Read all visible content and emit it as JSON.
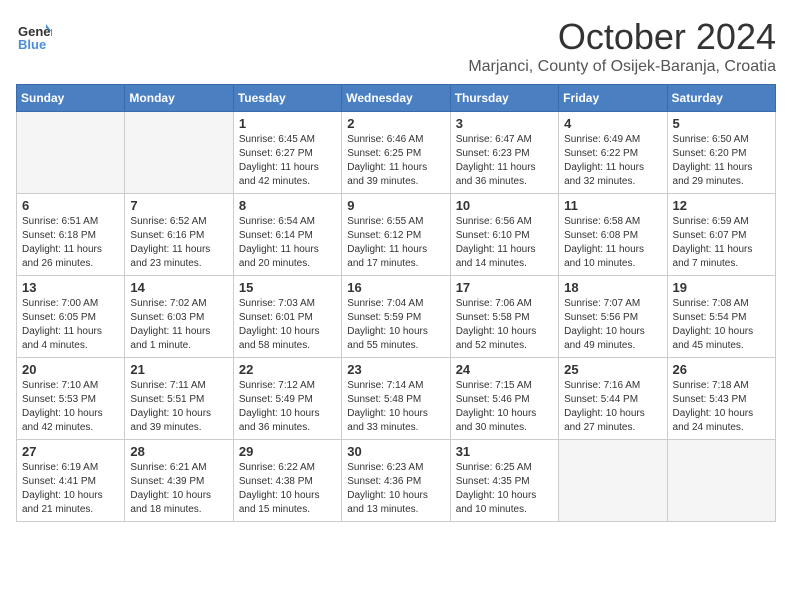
{
  "header": {
    "logo_line1": "General",
    "logo_line2": "Blue",
    "month_title": "October 2024",
    "subtitle": "Marjanci, County of Osijek-Baranja, Croatia"
  },
  "days_of_week": [
    "Sunday",
    "Monday",
    "Tuesday",
    "Wednesday",
    "Thursday",
    "Friday",
    "Saturday"
  ],
  "weeks": [
    [
      {
        "day": "",
        "info": ""
      },
      {
        "day": "",
        "info": ""
      },
      {
        "day": "1",
        "info": "Sunrise: 6:45 AM\nSunset: 6:27 PM\nDaylight: 11 hours and 42 minutes."
      },
      {
        "day": "2",
        "info": "Sunrise: 6:46 AM\nSunset: 6:25 PM\nDaylight: 11 hours and 39 minutes."
      },
      {
        "day": "3",
        "info": "Sunrise: 6:47 AM\nSunset: 6:23 PM\nDaylight: 11 hours and 36 minutes."
      },
      {
        "day": "4",
        "info": "Sunrise: 6:49 AM\nSunset: 6:22 PM\nDaylight: 11 hours and 32 minutes."
      },
      {
        "day": "5",
        "info": "Sunrise: 6:50 AM\nSunset: 6:20 PM\nDaylight: 11 hours and 29 minutes."
      }
    ],
    [
      {
        "day": "6",
        "info": "Sunrise: 6:51 AM\nSunset: 6:18 PM\nDaylight: 11 hours and 26 minutes."
      },
      {
        "day": "7",
        "info": "Sunrise: 6:52 AM\nSunset: 6:16 PM\nDaylight: 11 hours and 23 minutes."
      },
      {
        "day": "8",
        "info": "Sunrise: 6:54 AM\nSunset: 6:14 PM\nDaylight: 11 hours and 20 minutes."
      },
      {
        "day": "9",
        "info": "Sunrise: 6:55 AM\nSunset: 6:12 PM\nDaylight: 11 hours and 17 minutes."
      },
      {
        "day": "10",
        "info": "Sunrise: 6:56 AM\nSunset: 6:10 PM\nDaylight: 11 hours and 14 minutes."
      },
      {
        "day": "11",
        "info": "Sunrise: 6:58 AM\nSunset: 6:08 PM\nDaylight: 11 hours and 10 minutes."
      },
      {
        "day": "12",
        "info": "Sunrise: 6:59 AM\nSunset: 6:07 PM\nDaylight: 11 hours and 7 minutes."
      }
    ],
    [
      {
        "day": "13",
        "info": "Sunrise: 7:00 AM\nSunset: 6:05 PM\nDaylight: 11 hours and 4 minutes."
      },
      {
        "day": "14",
        "info": "Sunrise: 7:02 AM\nSunset: 6:03 PM\nDaylight: 11 hours and 1 minute."
      },
      {
        "day": "15",
        "info": "Sunrise: 7:03 AM\nSunset: 6:01 PM\nDaylight: 10 hours and 58 minutes."
      },
      {
        "day": "16",
        "info": "Sunrise: 7:04 AM\nSunset: 5:59 PM\nDaylight: 10 hours and 55 minutes."
      },
      {
        "day": "17",
        "info": "Sunrise: 7:06 AM\nSunset: 5:58 PM\nDaylight: 10 hours and 52 minutes."
      },
      {
        "day": "18",
        "info": "Sunrise: 7:07 AM\nSunset: 5:56 PM\nDaylight: 10 hours and 49 minutes."
      },
      {
        "day": "19",
        "info": "Sunrise: 7:08 AM\nSunset: 5:54 PM\nDaylight: 10 hours and 45 minutes."
      }
    ],
    [
      {
        "day": "20",
        "info": "Sunrise: 7:10 AM\nSunset: 5:53 PM\nDaylight: 10 hours and 42 minutes."
      },
      {
        "day": "21",
        "info": "Sunrise: 7:11 AM\nSunset: 5:51 PM\nDaylight: 10 hours and 39 minutes."
      },
      {
        "day": "22",
        "info": "Sunrise: 7:12 AM\nSunset: 5:49 PM\nDaylight: 10 hours and 36 minutes."
      },
      {
        "day": "23",
        "info": "Sunrise: 7:14 AM\nSunset: 5:48 PM\nDaylight: 10 hours and 33 minutes."
      },
      {
        "day": "24",
        "info": "Sunrise: 7:15 AM\nSunset: 5:46 PM\nDaylight: 10 hours and 30 minutes."
      },
      {
        "day": "25",
        "info": "Sunrise: 7:16 AM\nSunset: 5:44 PM\nDaylight: 10 hours and 27 minutes."
      },
      {
        "day": "26",
        "info": "Sunrise: 7:18 AM\nSunset: 5:43 PM\nDaylight: 10 hours and 24 minutes."
      }
    ],
    [
      {
        "day": "27",
        "info": "Sunrise: 6:19 AM\nSunset: 4:41 PM\nDaylight: 10 hours and 21 minutes."
      },
      {
        "day": "28",
        "info": "Sunrise: 6:21 AM\nSunset: 4:39 PM\nDaylight: 10 hours and 18 minutes."
      },
      {
        "day": "29",
        "info": "Sunrise: 6:22 AM\nSunset: 4:38 PM\nDaylight: 10 hours and 15 minutes."
      },
      {
        "day": "30",
        "info": "Sunrise: 6:23 AM\nSunset: 4:36 PM\nDaylight: 10 hours and 13 minutes."
      },
      {
        "day": "31",
        "info": "Sunrise: 6:25 AM\nSunset: 4:35 PM\nDaylight: 10 hours and 10 minutes."
      },
      {
        "day": "",
        "info": ""
      },
      {
        "day": "",
        "info": ""
      }
    ]
  ]
}
